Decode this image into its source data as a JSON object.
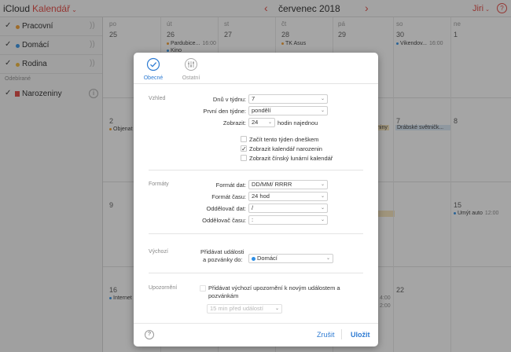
{
  "header": {
    "brand_prefix": "iCloud",
    "app_name": "Kalendář",
    "month_title": "červenec 2018",
    "user_name": "Jiri",
    "help": "?"
  },
  "sidebar": {
    "calendars": [
      {
        "name": "Pracovní",
        "color": "#f39c2a",
        "checked": "✓"
      },
      {
        "name": "Domácí",
        "color": "#2d8fe6",
        "checked": "✓"
      },
      {
        "name": "Rodina",
        "color": "#f2b632",
        "checked": "✓"
      }
    ],
    "section_subscribed": "Odebírané",
    "birthdays": {
      "name": "Narozeniny",
      "checked": "✓"
    }
  },
  "calendar": {
    "weekdays": [
      "po",
      "út",
      "st",
      "čt",
      "pá",
      "so",
      "ne"
    ],
    "days": [
      "25",
      "26",
      "27",
      "28",
      "29",
      "30",
      "1",
      "2",
      "7",
      "8",
      "9",
      "15",
      "16",
      "22"
    ],
    "events": [
      {
        "text": "Pardubice...",
        "time": "16:00",
        "color": "#f39c2a"
      },
      {
        "text": "Kino",
        "color": "#2d8fe6"
      },
      {
        "text": "TK Asus",
        "color": "#f39c2a"
      },
      {
        "text": "Vikendov...",
        "time": "16:00",
        "color": "#2d8fe6"
      },
      {
        "text": "Objenat",
        "color": "#f39c2a"
      },
      {
        "text": "niny",
        "color": "#f2b632"
      },
      {
        "text": "Drábské světničk...",
        "color": "#2d8fe6"
      },
      {
        "text": "Umýt auto",
        "time": "12:00",
        "color": "#2d8fe6"
      },
      {
        "text": "Internet",
        "color": "#2d8fe6"
      },
      {
        "text": "4:00"
      },
      {
        "text": "2:00"
      }
    ]
  },
  "modal": {
    "tabs": {
      "general": "Obecné",
      "other": "Ostatní"
    },
    "sections": {
      "appearance": "Vzhled",
      "formats": "Formáty",
      "default": "Výchozí",
      "alerts": "Upozornění"
    },
    "appearance": {
      "days_in_week_label": "Dnů v týdnu:",
      "days_in_week_value": "7",
      "first_day_label": "První den týdne:",
      "first_day_value": "pondělí",
      "show_label": "Zobrazit:",
      "show_value": "24",
      "show_suffix": "hodin najednou",
      "start_today_label": "Začít tento týden dneškem",
      "start_today_checked": "",
      "show_birthdays_label": "Zobrazit kalendář narozenin",
      "show_birthdays_checked": "✓",
      "show_chinese_label": "Zobrazit čínský lunární kalendář",
      "show_chinese_checked": ""
    },
    "formats": {
      "date_format_label": "Formát dat:",
      "date_format_value": "DD/MM/ RRRR",
      "time_format_label": "Formát času:",
      "time_format_value": "24 hod",
      "date_sep_label": "Oddělovač dat:",
      "date_sep_value": "/",
      "time_sep_label": "Oddělovač času:",
      "time_sep_value": ":"
    },
    "default": {
      "add_events_label_1": "Přidávat události",
      "add_events_label_2": "a pozvánky do:",
      "calendar_value": "Domácí",
      "calendar_color": "#2d8fe6"
    },
    "alerts": {
      "checkbox_label_1": "Přidávat výchozí upozornění k novým událostem a",
      "checkbox_label_2": "pozvánkám",
      "checked": "",
      "alert_select": "15 min před událostí"
    },
    "footer": {
      "help": "?",
      "cancel": "Zrušit",
      "save": "Uložit"
    }
  }
}
